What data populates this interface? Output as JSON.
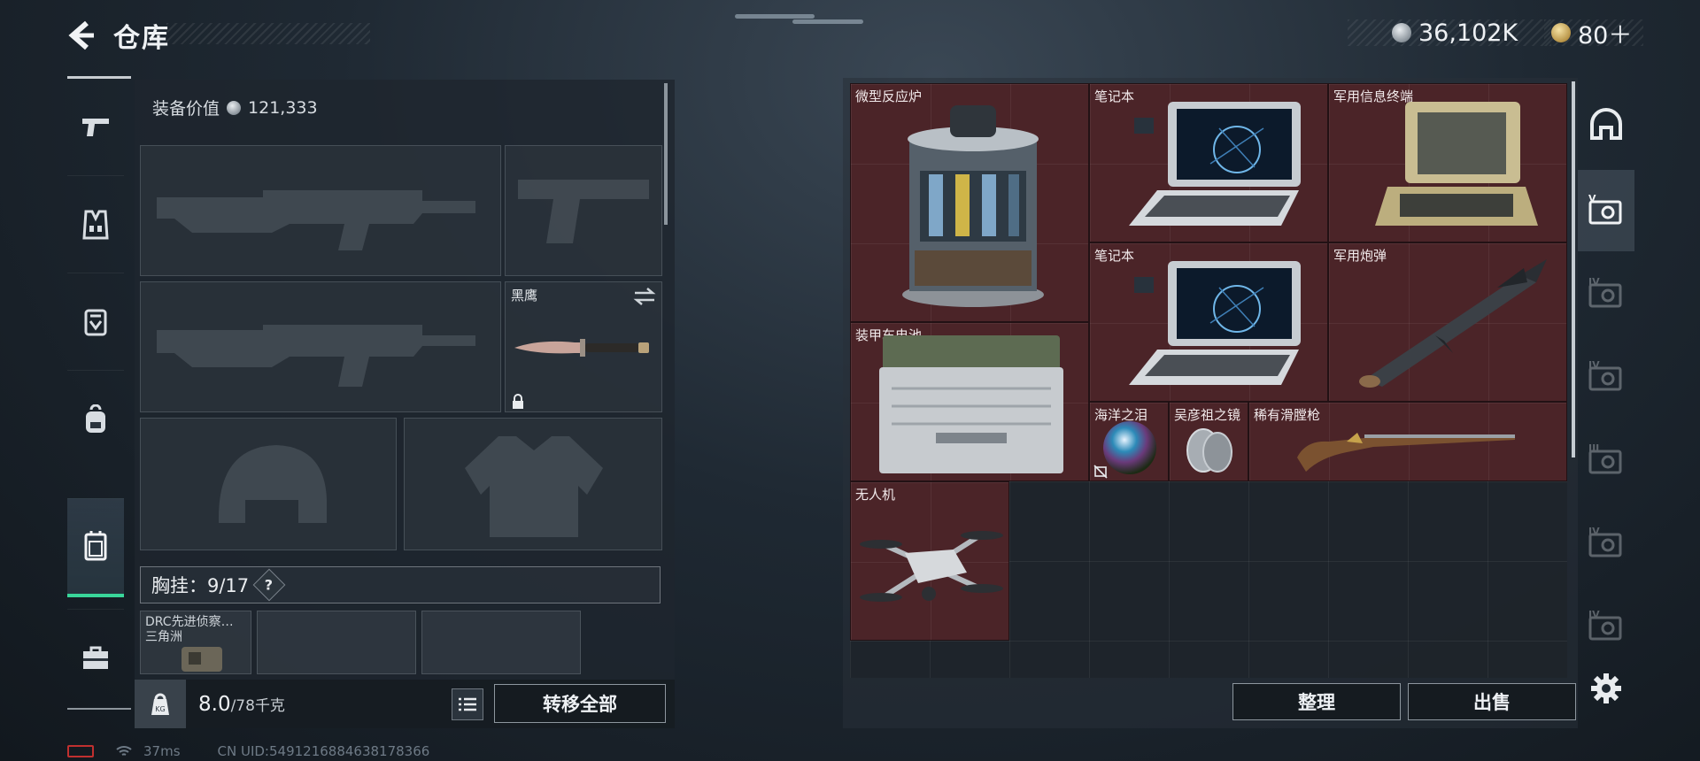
{
  "header": {
    "title": "仓库"
  },
  "currencies": [
    {
      "icon": "silver-coin-icon",
      "value": "36,102K"
    },
    {
      "icon": "gold-coin-icon",
      "value": "80＋"
    }
  ],
  "side_nav": [
    {
      "icon": "gun-icon",
      "active": false
    },
    {
      "icon": "vest-icon",
      "active": false
    },
    {
      "icon": "armor-plate-icon",
      "active": false
    },
    {
      "icon": "backpack-icon",
      "active": false
    },
    {
      "icon": "chest-rig-icon",
      "active": true
    },
    {
      "icon": "toolbox-icon",
      "active": false
    }
  ],
  "equipment": {
    "value_label": "装备价值",
    "value": "121,333",
    "melee_name": "黑鹰",
    "chest_rig_label": "胸挂：9/17",
    "help_label": "?",
    "pouch_items": [
      {
        "line1": "DRC先进侦察…",
        "line2": "三角洲"
      }
    ],
    "weight_current": "8.0",
    "weight_max": "/78千克",
    "transfer_all": "转移全部"
  },
  "stash": {
    "items": [
      {
        "name": "微型反应炉"
      },
      {
        "name": "笔记本"
      },
      {
        "name": "军用信息终端"
      },
      {
        "name": "笔记本"
      },
      {
        "name": "军用炮弹"
      },
      {
        "name": "装甲车电池"
      },
      {
        "name": "海洋之泪"
      },
      {
        "name": "吴彦祖之镜"
      },
      {
        "name": "稀有滑膛枪"
      },
      {
        "name": "无人机"
      }
    ],
    "sort_label": "整理",
    "sell_label": "出售"
  },
  "right_tabs": [
    {
      "icon": "helmet-tab-icon",
      "roman": ""
    },
    {
      "icon": "case-tab-icon",
      "roman": "V"
    },
    {
      "icon": "case-tab-icon",
      "roman": "IV"
    },
    {
      "icon": "case-tab-icon",
      "roman": "IV"
    },
    {
      "icon": "case-tab-icon",
      "roman": "III"
    },
    {
      "icon": "case-tab-icon",
      "roman": "IV"
    },
    {
      "icon": "case-tab-icon",
      "roman": "IV"
    }
  ],
  "status_bar": {
    "ping": "37ms",
    "uid": "CN UID:5491216884638178366"
  },
  "colors": {
    "accent_green": "#39d69a",
    "item_bg_red": "#4b2428"
  }
}
